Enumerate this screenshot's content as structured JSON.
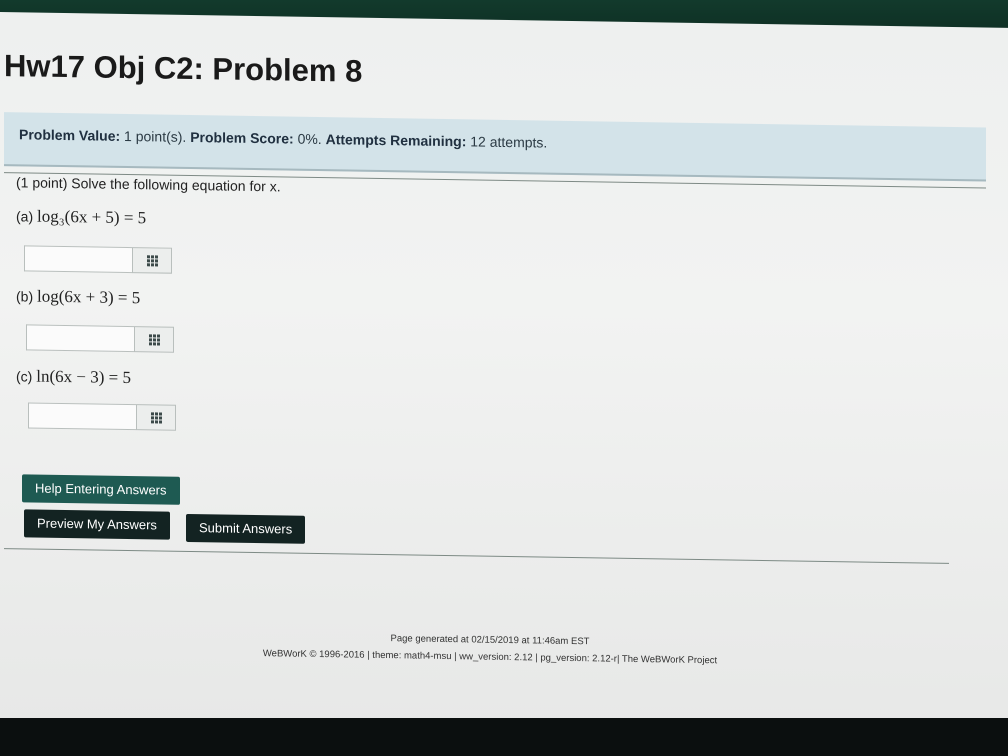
{
  "page": {
    "title": "Hw17 Obj C2: Problem 8"
  },
  "problem_info": {
    "value_label": "Problem Value:",
    "value_text": "1 point(s).",
    "score_label": "Problem Score:",
    "score_text": "0%.",
    "attempts_label": "Attempts Remaining:",
    "attempts_text": "12 attempts."
  },
  "problem": {
    "prompt": "(1 point) Solve the following equation for x.",
    "parts": [
      {
        "label": "(a)",
        "equation": "log₃(6x + 5) = 5",
        "answer": ""
      },
      {
        "label": "(b)",
        "equation": "log(6x + 3) = 5",
        "answer": ""
      },
      {
        "label": "(c)",
        "equation": "ln(6x − 3) = 5",
        "answer": ""
      }
    ]
  },
  "buttons": {
    "help": "Help Entering Answers",
    "preview": "Preview My Answers",
    "submit": "Submit Answers"
  },
  "footer": {
    "generated": "Page generated at 02/15/2019 at 11:46am EST",
    "credits": "WeBWorK © 1996-2016 | theme: math4-msu | ww_version: 2.12 | pg_version: 2.12-r| The WeBWorK Project"
  },
  "icons": {
    "answer_helper": "grid-icon"
  }
}
